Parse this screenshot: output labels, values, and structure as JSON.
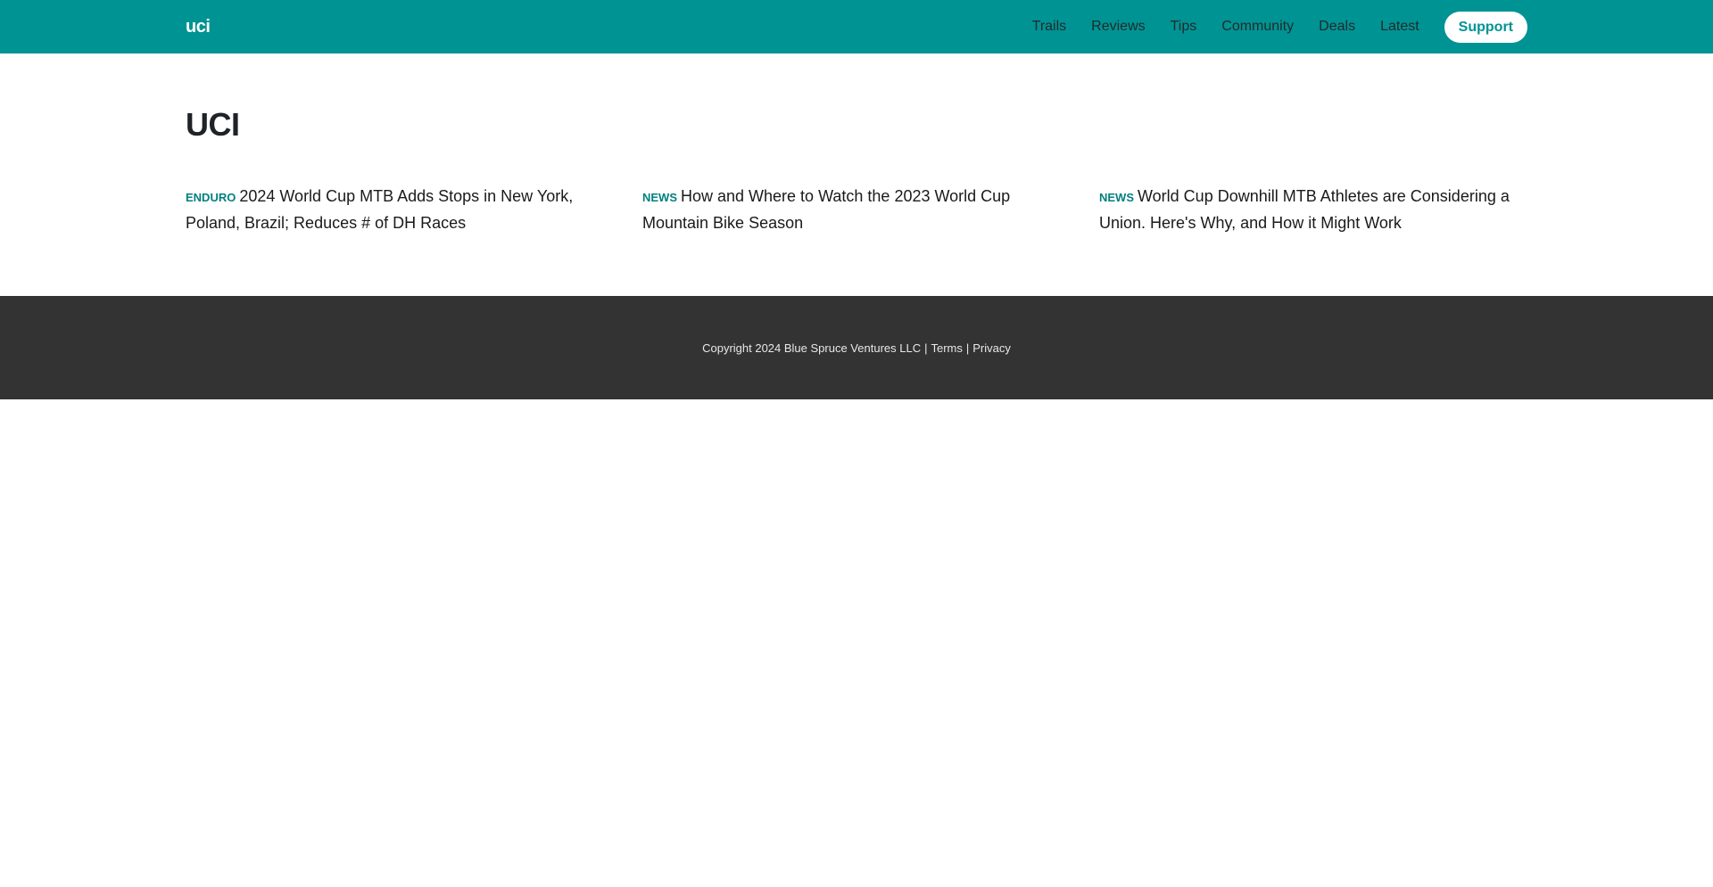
{
  "header": {
    "logo": "uci",
    "nav": [
      "Trails",
      "Reviews",
      "Tips",
      "Community",
      "Deals",
      "Latest"
    ],
    "support_label": "Support"
  },
  "main": {
    "title": "UCI",
    "articles": [
      {
        "tag": "ENDURO",
        "title": "2024 World Cup MTB Adds Stops in New York, Poland, Brazil; Reduces # of DH Races"
      },
      {
        "tag": "NEWS",
        "title": "How and Where to Watch the 2023 World Cup Mountain Bike Season"
      },
      {
        "tag": "NEWS",
        "title": "World Cup Downhill MTB Athletes are Considering a Union. Here's Why, and How it Might Work"
      }
    ]
  },
  "footer": {
    "copyright": "Copyright 2024 Blue Spruce Ventures LLC",
    "separator": "|",
    "terms": "Terms",
    "privacy": "Privacy"
  },
  "colors": {
    "header_bg": "#009394",
    "accent": "#00807f",
    "footer_bg": "#333333"
  }
}
